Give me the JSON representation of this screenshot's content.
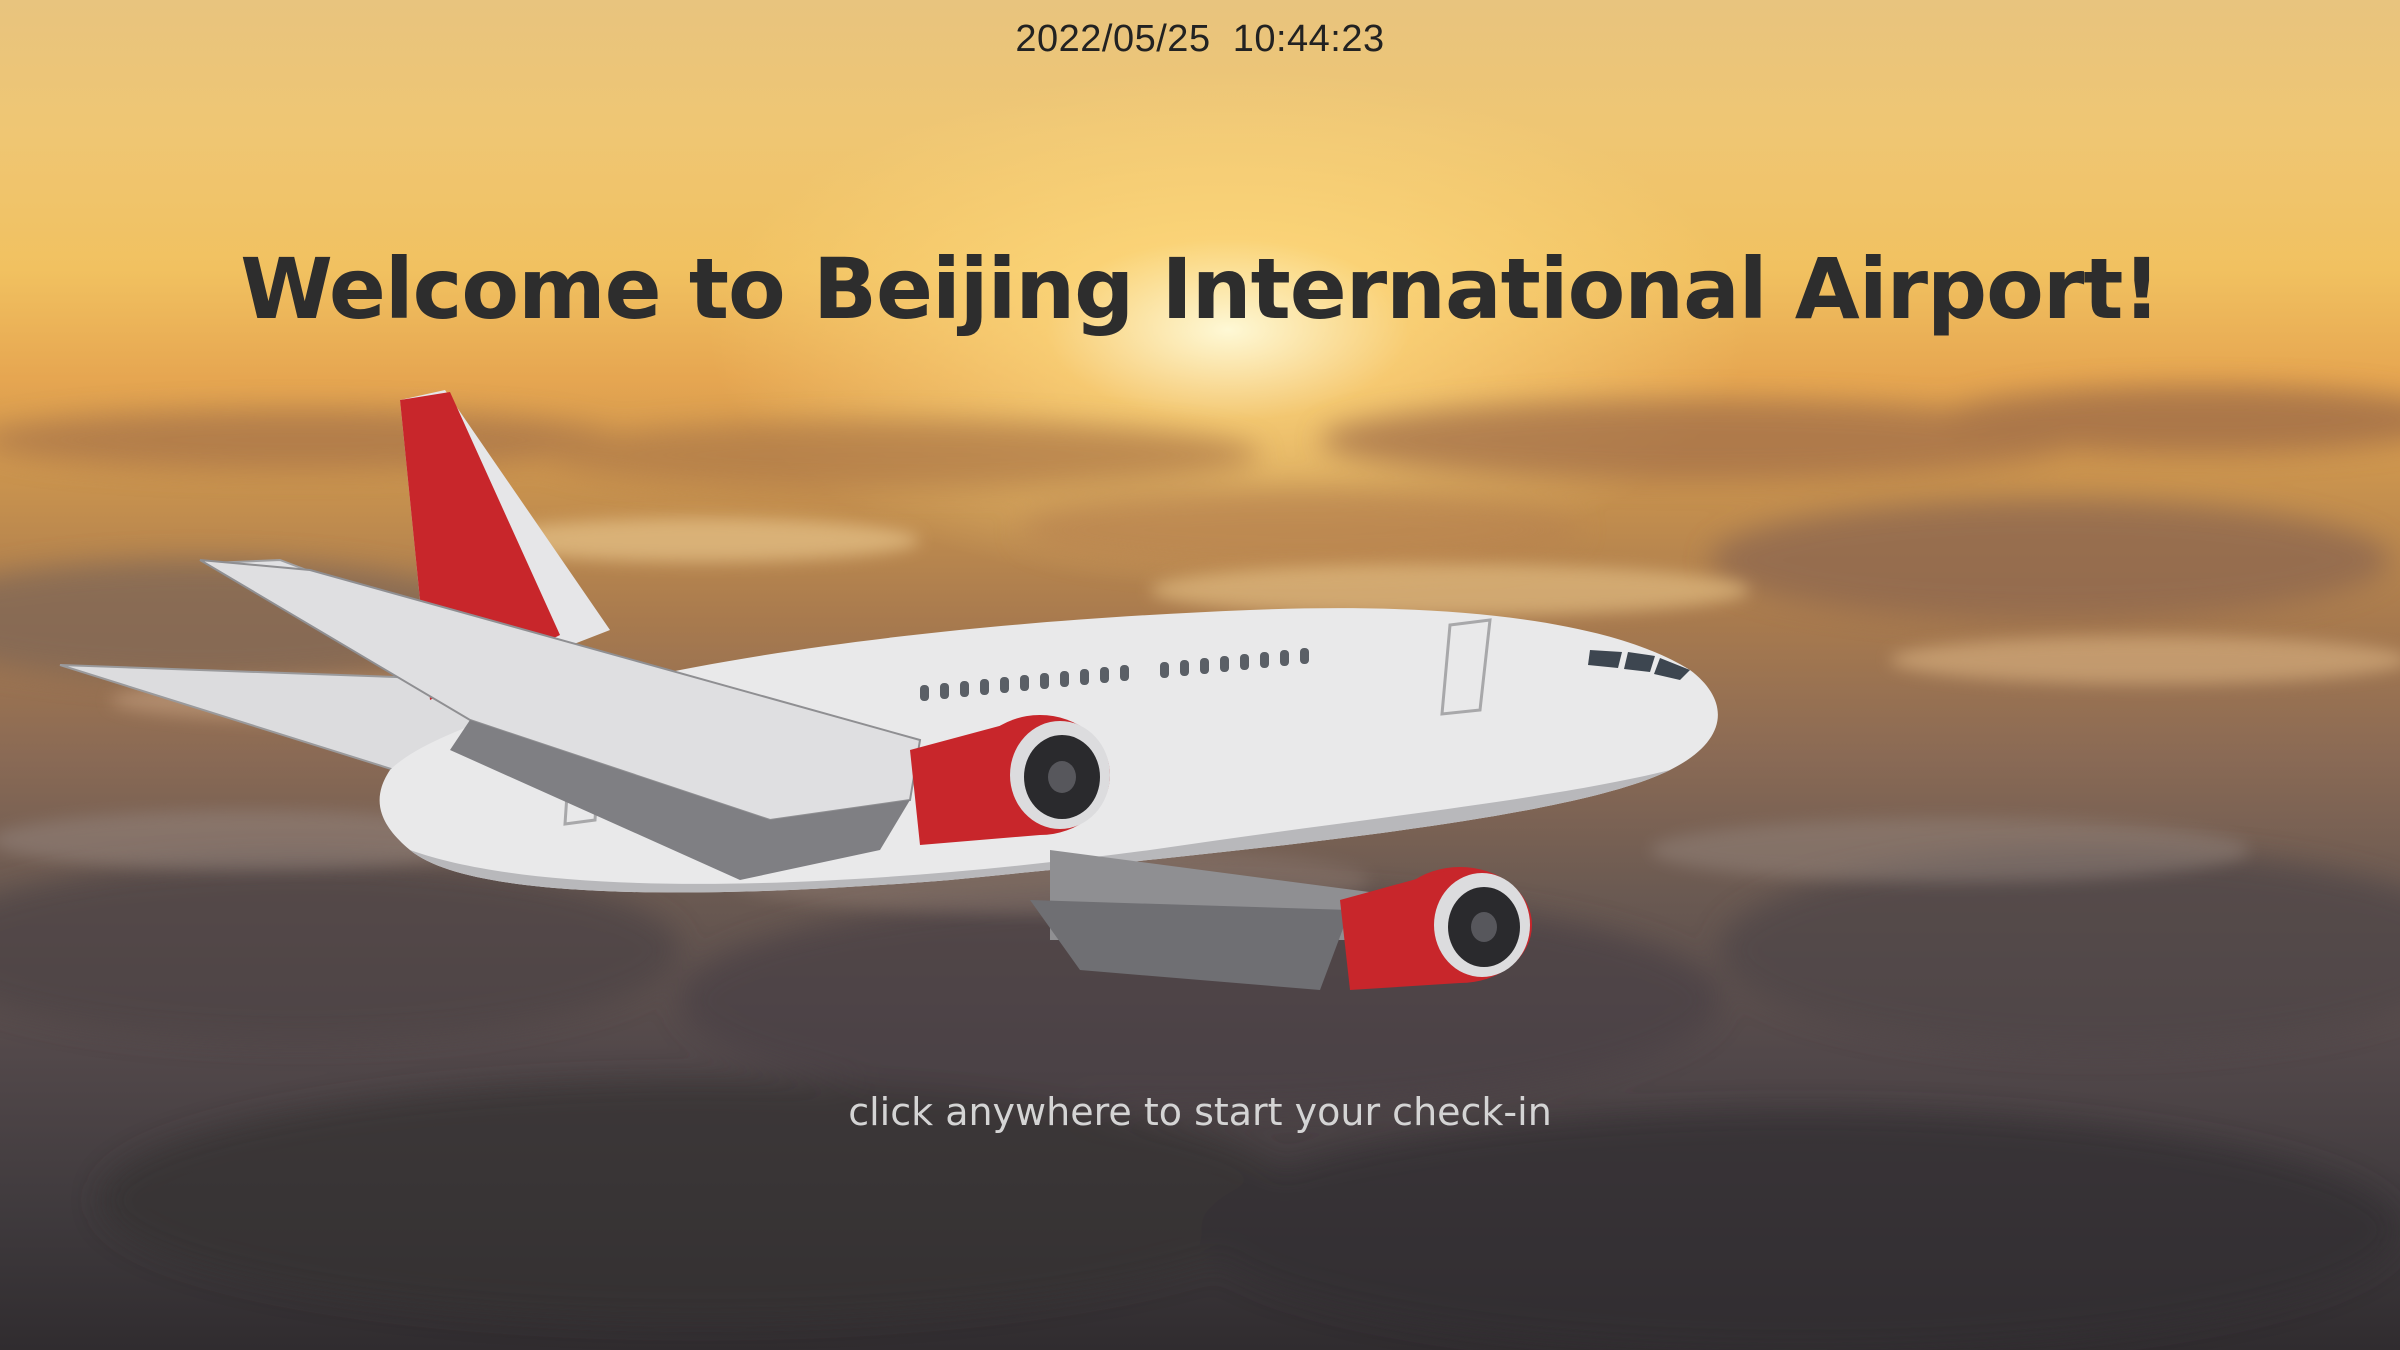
{
  "status_bar": {
    "datetime": "2022/05/25  10:44:23"
  },
  "hero": {
    "title": "Welcome to Beijing International Airport!",
    "prompt": "click anywhere to start your check-in"
  },
  "background": {
    "subject": "airplane-above-clouds-at-sunset",
    "sky_color": "#f1c160",
    "cloud_shadow_color": "#302c2f"
  },
  "airplane": {
    "livery_accent": "#c8262b",
    "fuselage_color": "#e9e9ea"
  }
}
